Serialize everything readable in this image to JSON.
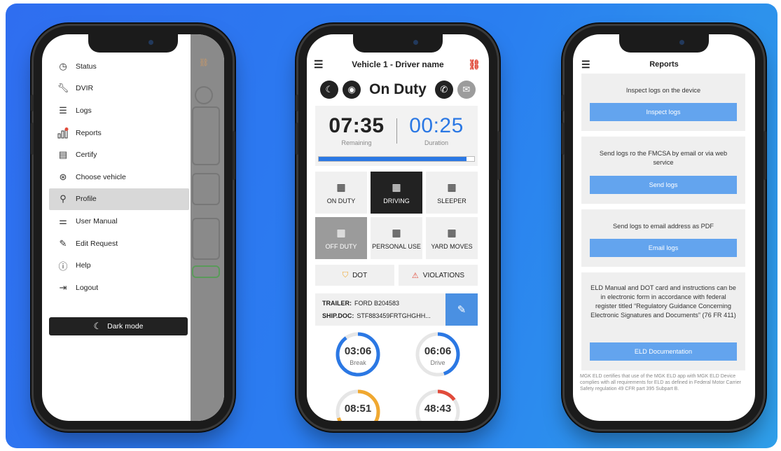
{
  "menu": {
    "items": [
      {
        "label": "Status",
        "icon": "clock-icon",
        "active": false
      },
      {
        "label": "DVIR",
        "icon": "wrench-icon",
        "active": false
      },
      {
        "label": "Logs",
        "icon": "list-icon",
        "active": false
      },
      {
        "label": "Reports",
        "icon": "bar-chart-icon",
        "active": false
      },
      {
        "label": "Certify",
        "icon": "document-icon",
        "active": false
      },
      {
        "label": "Choose vehicle",
        "icon": "steering-wheel-icon",
        "active": false
      },
      {
        "label": "Profile",
        "icon": "user-icon",
        "active": true
      },
      {
        "label": "User Manual",
        "icon": "manual-icon",
        "active": false
      },
      {
        "label": "Edit Request",
        "icon": "pencil-icon",
        "active": false
      },
      {
        "label": "Help",
        "icon": "help-icon",
        "active": false
      },
      {
        "label": "Logout",
        "icon": "logout-icon",
        "active": false
      }
    ],
    "dark_mode_label": "Dark mode"
  },
  "dashboard": {
    "title": "Vehicle 1 - Driver name",
    "status": "On Duty",
    "remaining_time": "07:35",
    "remaining_label": "Remaining",
    "duration_time": "00:25",
    "duration_label": "Duration",
    "progress_percent": 95,
    "duty_statuses": [
      {
        "label": "ON DUTY",
        "style": "light"
      },
      {
        "label": "DRIVING",
        "style": "black"
      },
      {
        "label": "SLEEPER",
        "style": "light"
      },
      {
        "label": "OFF DUTY",
        "style": "grey"
      },
      {
        "label": "PERSONAL USE",
        "style": "light"
      },
      {
        "label": "YARD MOVES",
        "style": "light"
      }
    ],
    "dot_label": "DOT",
    "violations_label": "VIOLATIONS",
    "trailer_key": "TRAILER:",
    "trailer_value": "FORD B204583",
    "shipdoc_key": "SHIP.DOC:",
    "shipdoc_value": "STF883459FRTGHGHH...",
    "gauges": [
      {
        "time": "03:06",
        "label": "Break",
        "color": "#2b78e4",
        "fraction": 0.9
      },
      {
        "time": "06:06",
        "label": "Drive",
        "color": "#2b78e4",
        "fraction": 0.45
      },
      {
        "time": "08:51",
        "label": "",
        "color": "#f0a830",
        "fraction": 0.7
      },
      {
        "time": "48:43",
        "label": "",
        "color": "#e14b3b",
        "fraction": 0.15
      }
    ],
    "colors": {
      "accent": "#2b78e4",
      "alert": "#e14b3b",
      "dot_badge": "#f0a830"
    }
  },
  "reports": {
    "title": "Reports",
    "cards": [
      {
        "text": "Inspect logs on the device",
        "button": "Inspect logs"
      },
      {
        "text": "Send logs ro the FMCSA by email or via web service",
        "button": "Send logs"
      },
      {
        "text": "Send logs to email address as PDF",
        "button": "Email logs"
      },
      {
        "text": "ELD Manual and DOT card and instructions can be in electronic form in accordance with federal register titled “Regulatory Guidance Concerning Electronic Signatures and Documents” (76 FR 411)",
        "button": "ELD Documentation"
      }
    ],
    "footer": "MGK ELD certifies that use of the MGK ELD app with MGK ELD Device complies with all requirements for ELD as defined in Federal Motor Carrier Safety regulation 49 CFR part 395 Subpart B.",
    "button_color": "#63a4ee"
  }
}
